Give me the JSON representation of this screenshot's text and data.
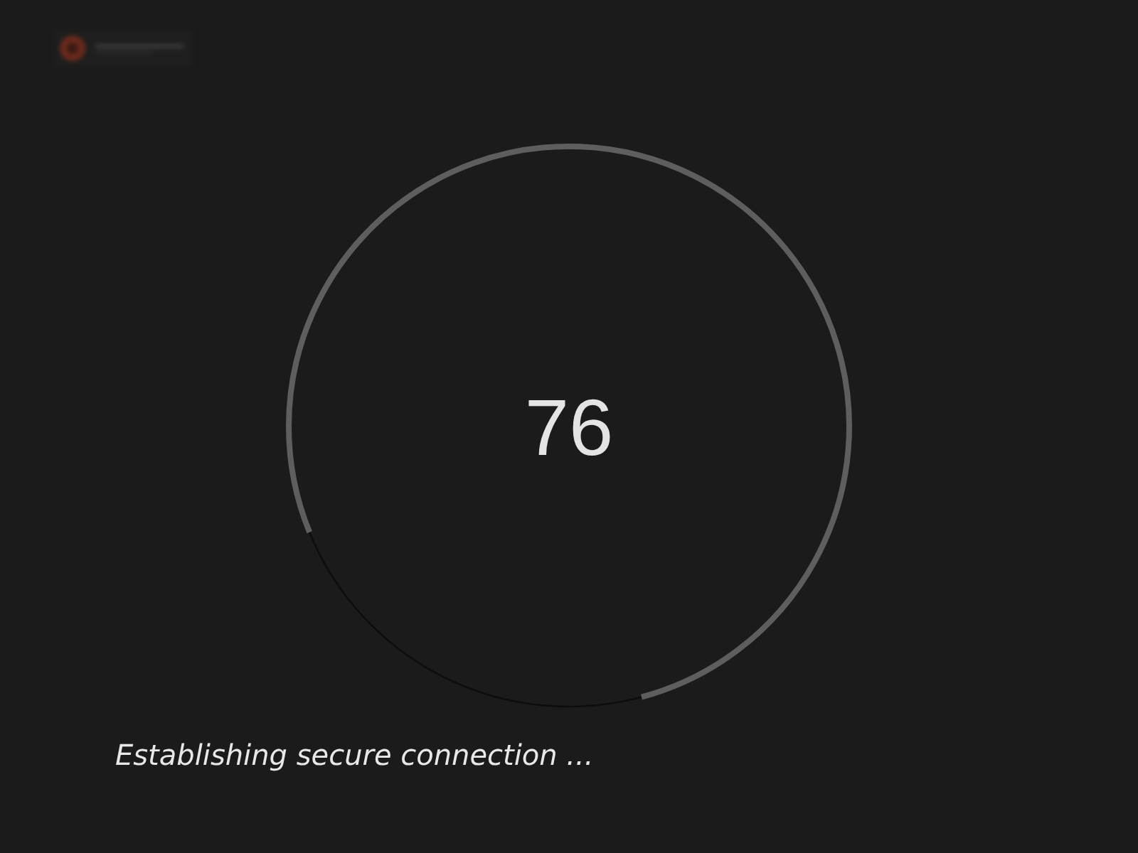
{
  "progress": {
    "value": "76"
  },
  "status": "Establishing secure connection ..."
}
